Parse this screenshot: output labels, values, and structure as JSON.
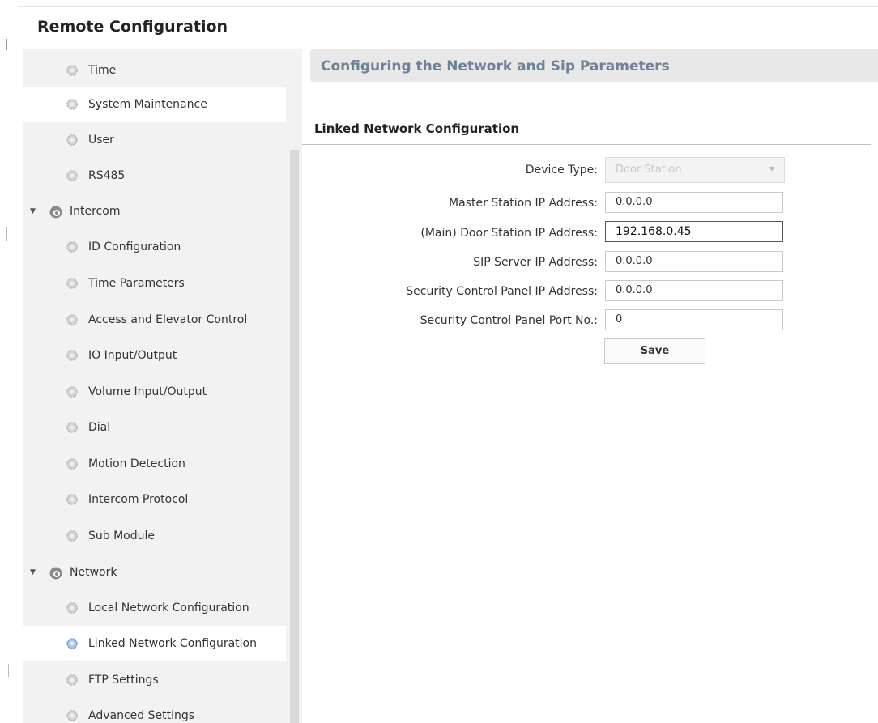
{
  "app": {
    "title": "Remote Configuration"
  },
  "sidebar": {
    "items": [
      {
        "label": "Time",
        "type": "sub"
      },
      {
        "label": "System Maintenance",
        "type": "sub"
      },
      {
        "label": "User",
        "type": "sub"
      },
      {
        "label": "RS485",
        "type": "sub"
      },
      {
        "label": "Intercom",
        "type": "group"
      },
      {
        "label": "ID Configuration",
        "type": "sub"
      },
      {
        "label": "Time Parameters",
        "type": "sub"
      },
      {
        "label": "Access and Elevator Control",
        "type": "sub"
      },
      {
        "label": "IO Input/Output",
        "type": "sub"
      },
      {
        "label": "Volume Input/Output",
        "type": "sub"
      },
      {
        "label": "Dial",
        "type": "sub"
      },
      {
        "label": "Motion Detection",
        "type": "sub"
      },
      {
        "label": "Intercom Protocol",
        "type": "sub"
      },
      {
        "label": "Sub Module",
        "type": "sub"
      },
      {
        "label": "Network",
        "type": "group"
      },
      {
        "label": "Local Network Configuration",
        "type": "sub"
      },
      {
        "label": "Linked Network Configuration",
        "type": "sub",
        "selected": true
      },
      {
        "label": "FTP Settings",
        "type": "sub"
      },
      {
        "label": "Advanced Settings",
        "type": "sub"
      }
    ]
  },
  "main": {
    "title": "Configuring the Network and Sip Parameters",
    "section_title": "Linked Network Configuration",
    "form": {
      "device_type": {
        "label": "Device Type:",
        "value": "Door Station"
      },
      "master_station_ip": {
        "label": "Master Station IP Address:",
        "value": "0.0.0.0"
      },
      "main_door_station_ip": {
        "label": "(Main) Door Station IP Address:",
        "value": "192.168.0.45"
      },
      "sip_server_ip": {
        "label": "SIP Server IP Address:",
        "value": "0.0.0.0"
      },
      "security_panel_ip": {
        "label": "Security Control Panel IP Address:",
        "value": "0.0.0.0"
      },
      "security_panel_port": {
        "label": "Security Control Panel Port No.:",
        "value": "0"
      },
      "save_label": "Save"
    }
  },
  "colors": {
    "sidebar_bg": "#f2f2f2",
    "header_bg": "#e8e8e8",
    "header_title": "#6f8196",
    "selected_icon": "#6b9bd2"
  },
  "icons": {
    "sub_item": "gear-icon",
    "group": "settings-globe-icon",
    "expand": "caret-down-icon"
  }
}
